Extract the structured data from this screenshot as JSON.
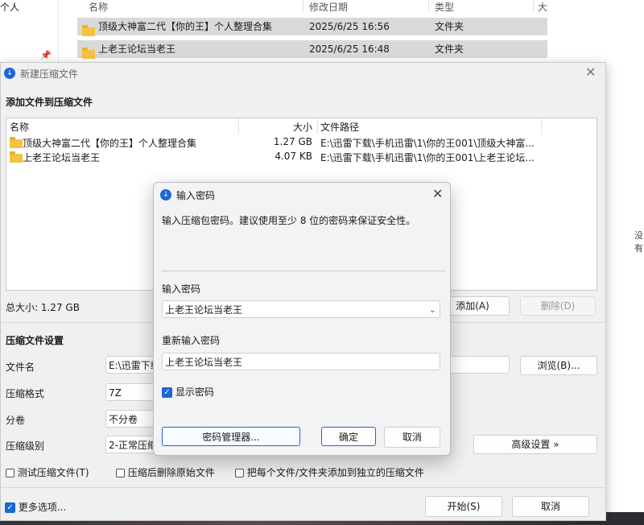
{
  "explorer": {
    "left_label": "个人",
    "columns": {
      "name": "名称",
      "modified": "修改日期",
      "type": "类型",
      "size": "大"
    },
    "rows": [
      {
        "name": "顶级大神富二代【你的王】个人整理合集",
        "modified": "2025/6/25 16:56",
        "type": "文件夹"
      },
      {
        "name": "上老王论坛当老王",
        "modified": "2025/6/25 16:48",
        "type": "文件夹"
      }
    ],
    "right_edge_text": "没有"
  },
  "main_dialog": {
    "title": "新建压缩文件",
    "section_add": "添加文件到压缩文件",
    "file_columns": {
      "name": "名称",
      "size": "大小",
      "path": "文件路径"
    },
    "files": [
      {
        "name": "顶级大神富二代【你的王】个人整理合集",
        "size": "1.27 GB",
        "path": "E:\\迅雷下载\\手机迅雷\\1\\你的王001\\顶级大神富..."
      },
      {
        "name": "上老王论坛当老王",
        "size": "4.07 KB",
        "path": "E:\\迅雷下载\\手机迅雷\\1\\你的王001\\上老王论坛..."
      }
    ],
    "total_size": "总大小: 1.27 GB",
    "add_button": "添加(A)",
    "delete_button": "删除(D)",
    "section_settings": "压缩文件设置",
    "filename_label": "文件名",
    "filename_value": "E:\\迅雷下载",
    "browse_button": "浏览(B)...",
    "format_label": "压缩格式",
    "format_value": "7Z",
    "split_label": "分卷",
    "split_value": "不分卷",
    "level_label": "压缩级别",
    "level_value": "2-正常压缩",
    "advanced_button": "高级设置 »",
    "test_check": "测试压缩文件(T)",
    "delete_after_check": "压缩后删除原始文件",
    "separate_check": "把每个文件/文件夹添加到独立的压缩文件",
    "more_options": "更多选项...",
    "start_button": "开始(S)",
    "cancel_button": "取消"
  },
  "password_dialog": {
    "title": "输入密码",
    "description": "输入压缩包密码。建议使用至少 8 位的密码来保证安全性。",
    "password_label": "输入密码",
    "password_value": "上老王论坛当老王",
    "reenter_label": "重新输入密码",
    "reenter_value": "上老王论坛当老王",
    "show_password": "显示密码",
    "manager_button": "密码管理器...",
    "ok_button": "确定",
    "cancel_button": "取消"
  },
  "colors": {
    "accent": "#1b67d6",
    "folder": "#f3c442",
    "selection": "#d9d9d9"
  }
}
